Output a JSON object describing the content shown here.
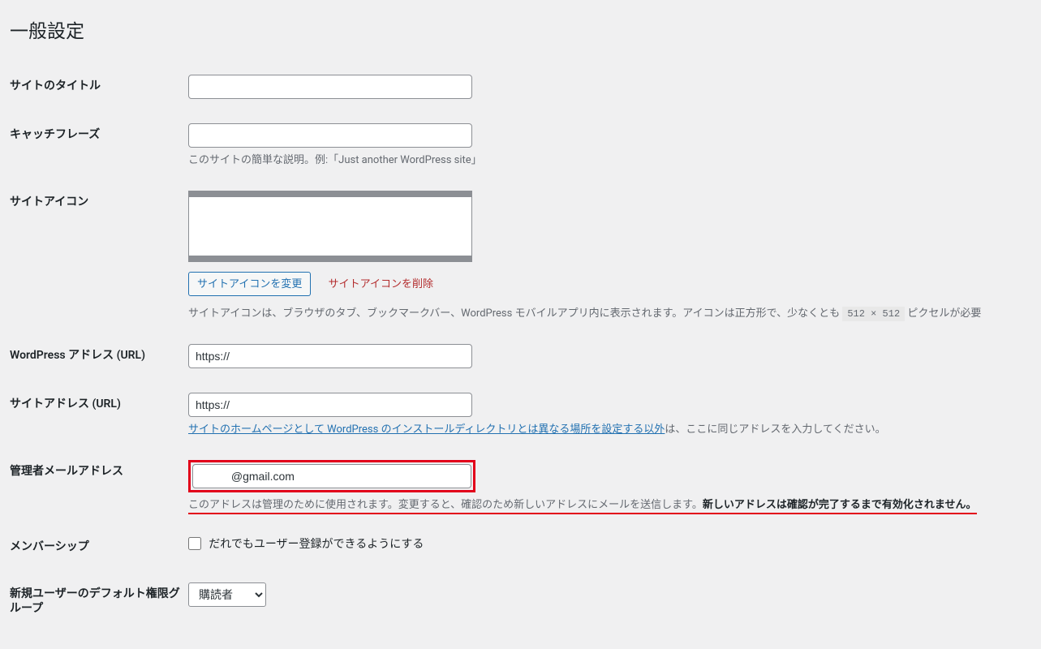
{
  "page": {
    "title": "一般設定"
  },
  "fields": {
    "site_title": {
      "label": "サイトのタイトル",
      "value": ""
    },
    "tagline": {
      "label": "キャッチフレーズ",
      "value": "",
      "description": "このサイトの簡単な説明。例:「Just another WordPress site」"
    },
    "site_icon": {
      "label": "サイトアイコン",
      "change_button": "サイトアイコンを変更",
      "remove_button": "サイトアイコンを削除",
      "description_pre": "サイトアイコンは、ブラウザのタブ、ブックマークバー、WordPress モバイルアプリ内に表示されます。アイコンは正方形で、少なくとも ",
      "size_code": "512 × 512",
      "description_post": " ピクセルが必要"
    },
    "wp_url": {
      "label": "WordPress アドレス (URL)",
      "value": "https://"
    },
    "site_url": {
      "label": "サイトアドレス (URL)",
      "value": "https://",
      "link_text": "サイトのホームページとして WordPress のインストールディレクトリとは異なる場所を設定する以外",
      "after_link": "は、ここに同じアドレスを入力してください。"
    },
    "admin_email": {
      "label": "管理者メールアドレス",
      "value": "          @gmail.com",
      "note_plain": "このアドレスは管理のために使用されます。変更すると、確認のため新しいアドレスにメールを送信します。",
      "note_bold": "新しいアドレスは確認が完了するまで有効化されません。"
    },
    "membership": {
      "label": "メンバーシップ",
      "checkbox_label": "だれでもユーザー登録ができるようにする",
      "checked": false
    },
    "default_role": {
      "label": "新規ユーザーのデフォルト権限グループ",
      "selected": "購読者"
    }
  }
}
